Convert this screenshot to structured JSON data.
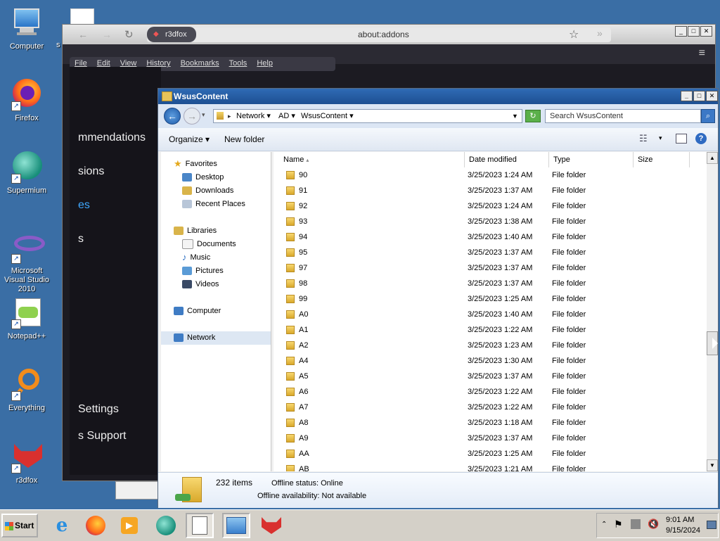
{
  "desktop": {
    "icons": [
      {
        "label": "Computer"
      },
      {
        "label": "Firefox"
      },
      {
        "label": "Supermium"
      },
      {
        "label": "Microsoft Visual Studio 2010"
      },
      {
        "label": "Notepad++"
      },
      {
        "label": "Everything"
      },
      {
        "label": "r3dfox"
      }
    ],
    "partial_icon_label": "s"
  },
  "browser": {
    "tab_label": "r3dfox",
    "url": "about:addons",
    "menu": [
      "File",
      "Edit",
      "View",
      "History",
      "Bookmarks",
      "Tools",
      "Help"
    ],
    "sidebar_fragments": [
      "mmendations",
      "sions",
      "es",
      "s",
      "Settings",
      "s Support"
    ]
  },
  "explorer": {
    "title": "WsusContent",
    "breadcrumbs": [
      "Network",
      "AD",
      "WsusContent"
    ],
    "search_placeholder": "Search WsusContent",
    "toolbar": {
      "organize": "Organize",
      "new_folder": "New folder"
    },
    "nav": {
      "favorites": "Favorites",
      "desktop": "Desktop",
      "downloads": "Downloads",
      "recent_places": "Recent Places",
      "libraries": "Libraries",
      "documents": "Documents",
      "music": "Music",
      "pictures": "Pictures",
      "videos": "Videos",
      "computer": "Computer",
      "network": "Network"
    },
    "columns": {
      "name": "Name",
      "date": "Date modified",
      "type": "Type",
      "size": "Size"
    },
    "rows": [
      {
        "name": "90",
        "date": "3/25/2023 1:24 AM",
        "type": "File folder"
      },
      {
        "name": "91",
        "date": "3/25/2023 1:37 AM",
        "type": "File folder"
      },
      {
        "name": "92",
        "date": "3/25/2023 1:24 AM",
        "type": "File folder"
      },
      {
        "name": "93",
        "date": "3/25/2023 1:38 AM",
        "type": "File folder"
      },
      {
        "name": "94",
        "date": "3/25/2023 1:40 AM",
        "type": "File folder"
      },
      {
        "name": "95",
        "date": "3/25/2023 1:37 AM",
        "type": "File folder"
      },
      {
        "name": "97",
        "date": "3/25/2023 1:37 AM",
        "type": "File folder"
      },
      {
        "name": "98",
        "date": "3/25/2023 1:37 AM",
        "type": "File folder"
      },
      {
        "name": "99",
        "date": "3/25/2023 1:25 AM",
        "type": "File folder"
      },
      {
        "name": "A0",
        "date": "3/25/2023 1:40 AM",
        "type": "File folder"
      },
      {
        "name": "A1",
        "date": "3/25/2023 1:22 AM",
        "type": "File folder"
      },
      {
        "name": "A2",
        "date": "3/25/2023 1:23 AM",
        "type": "File folder"
      },
      {
        "name": "A4",
        "date": "3/25/2023 1:30 AM",
        "type": "File folder"
      },
      {
        "name": "A5",
        "date": "3/25/2023 1:37 AM",
        "type": "File folder"
      },
      {
        "name": "A6",
        "date": "3/25/2023 1:22 AM",
        "type": "File folder"
      },
      {
        "name": "A7",
        "date": "3/25/2023 1:22 AM",
        "type": "File folder"
      },
      {
        "name": "A8",
        "date": "3/25/2023 1:18 AM",
        "type": "File folder"
      },
      {
        "name": "A9",
        "date": "3/25/2023 1:37 AM",
        "type": "File folder"
      },
      {
        "name": "AA",
        "date": "3/25/2023 1:25 AM",
        "type": "File folder"
      },
      {
        "name": "AB",
        "date": "3/25/2023 1:21 AM",
        "type": "File folder"
      }
    ],
    "details": {
      "item_count": "232 items",
      "offline_status_label": "Offline status:",
      "offline_status_value": "Online",
      "offline_availability_label": "Offline availability:",
      "offline_availability_value": "Not available"
    }
  },
  "taskbar": {
    "start_label": "Start",
    "clock_time": "9:01 AM",
    "clock_date": "9/15/2024"
  },
  "colors": {
    "desktop": "#3a6ea5",
    "explorer_title": "#1d4f92",
    "browser_bg": "#1c1b22"
  }
}
